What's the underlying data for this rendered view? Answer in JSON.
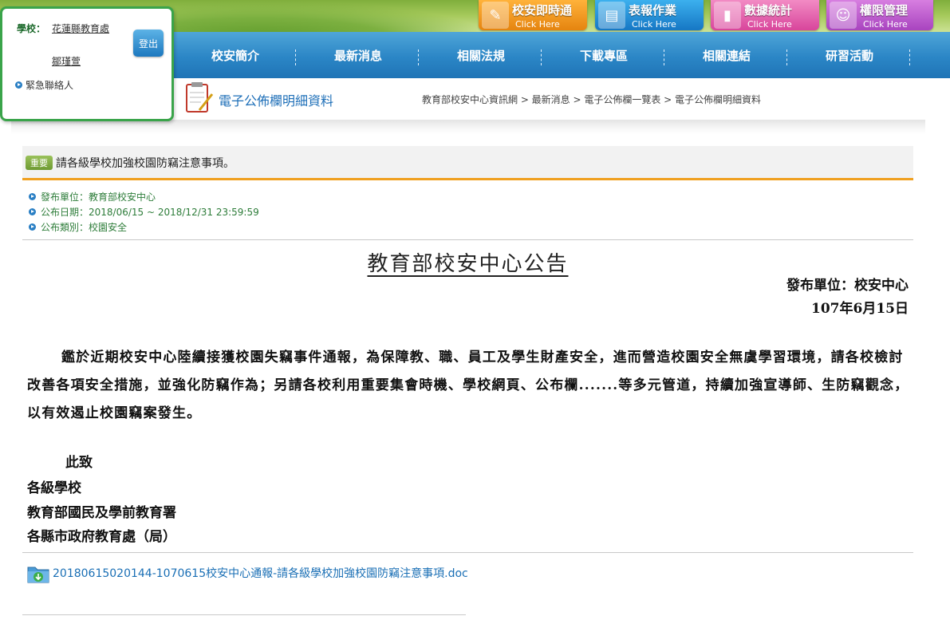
{
  "quick_buttons": [
    {
      "label": "校安即時通",
      "sub": "Click Here",
      "icon": "bell-icon",
      "color": "#f39b1a"
    },
    {
      "label": "表報作業",
      "sub": "Click Here",
      "icon": "report-icon",
      "color": "#1d8fd6"
    },
    {
      "label": "數據統計",
      "sub": "Click Here",
      "icon": "chart-icon",
      "color": "#e45fa6"
    },
    {
      "label": "權限管理",
      "sub": "Click Here",
      "icon": "person-icon",
      "color": "#c35fd0"
    }
  ],
  "nav": [
    "校安簡介",
    "最新消息",
    "相關法規",
    "下載專區",
    "相關連結",
    "研習活動"
  ],
  "login": {
    "school_label": "學校：",
    "school_name": "花蓮縣教育處",
    "user_name": "鄒瑾萱",
    "logout": "登出",
    "emergency": "緊急聯絡人"
  },
  "page": {
    "title": "電子公佈欄明細資料",
    "breadcrumb": "教育部校安中心資訊網 > 最新消息 > 電子公佈欄一覽表 > 電子公佈欄明細資料"
  },
  "announcement": {
    "badge": "重要",
    "title": "請各級學校加強校園防竊注意事項。",
    "meta": [
      "發布單位：教育部校安中心",
      "公布日期：2018/06/15 ~ 2018/12/31 23:59:59",
      "公布類別：校園安全"
    ]
  },
  "document": {
    "heading": "教育部校安中心公告",
    "issuer": "發布單位：校安中心",
    "date": "107年6月15日",
    "body": "鑑於近期校安中心陸續接獲校園失竊事件通報，為保障教、職、員工及學生財產安全，進而營造校園安全無虞學習環境，請各校檢討改善各項安全措施，並強化防竊作為；另請各校利用重要集會時機、學校網頁、公布欄.......等多元管道，持續加強宣導師、生防竊觀念，以有效遏止校園竊案發生。",
    "salutation": "此致",
    "recipients": [
      "各級學校",
      "教育部國民及學前教育署",
      "各縣市政府教育處（局）"
    ]
  },
  "attachment": {
    "filename": "20180615020144-1070615校安中心通報-請各級學校加強校園防竊注意事項.doc",
    "icon": "folder-download-icon"
  }
}
